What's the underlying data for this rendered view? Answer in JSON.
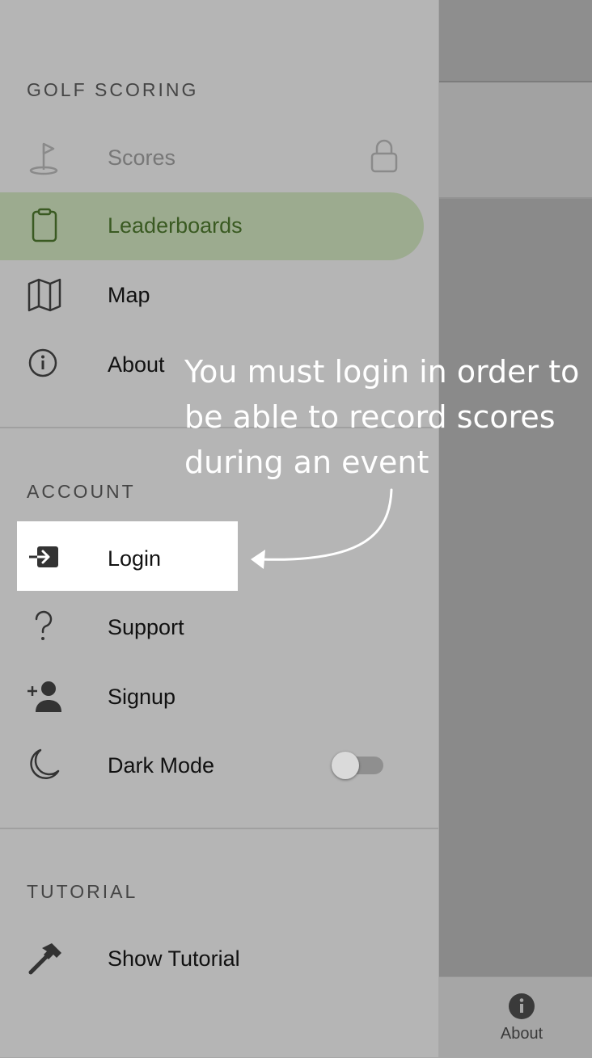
{
  "background": {
    "tab_about_label": "About"
  },
  "drawer": {
    "golf_scoring": {
      "title": "GOLF SCORING",
      "items": [
        {
          "label": "Scores",
          "icon": "golf-flag-icon",
          "locked": true
        },
        {
          "label": "Leaderboards",
          "icon": "clipboard-icon",
          "active": true
        },
        {
          "label": "Map",
          "icon": "map-icon"
        },
        {
          "label": "About",
          "icon": "info-icon"
        }
      ]
    },
    "account": {
      "title": "ACCOUNT",
      "items": [
        {
          "label": "Login",
          "icon": "login-icon",
          "highlighted": true
        },
        {
          "label": "Support",
          "icon": "question-icon"
        },
        {
          "label": "Signup",
          "icon": "add-person-icon"
        },
        {
          "label": "Dark Mode",
          "icon": "moon-icon",
          "toggle_on": false
        }
      ]
    },
    "tutorial": {
      "title": "TUTORIAL",
      "items": [
        {
          "label": "Show Tutorial",
          "icon": "hammer-icon"
        }
      ]
    }
  },
  "annotation": {
    "lines": [
      "You must login in order to",
      "be able to record scores",
      "during an event"
    ]
  },
  "colors": {
    "drawer_bg": "#b5b5b5",
    "active_item_bg": "#9cab8f",
    "active_item_text": "#3a5a22",
    "highlight_box": "#ffffff"
  }
}
